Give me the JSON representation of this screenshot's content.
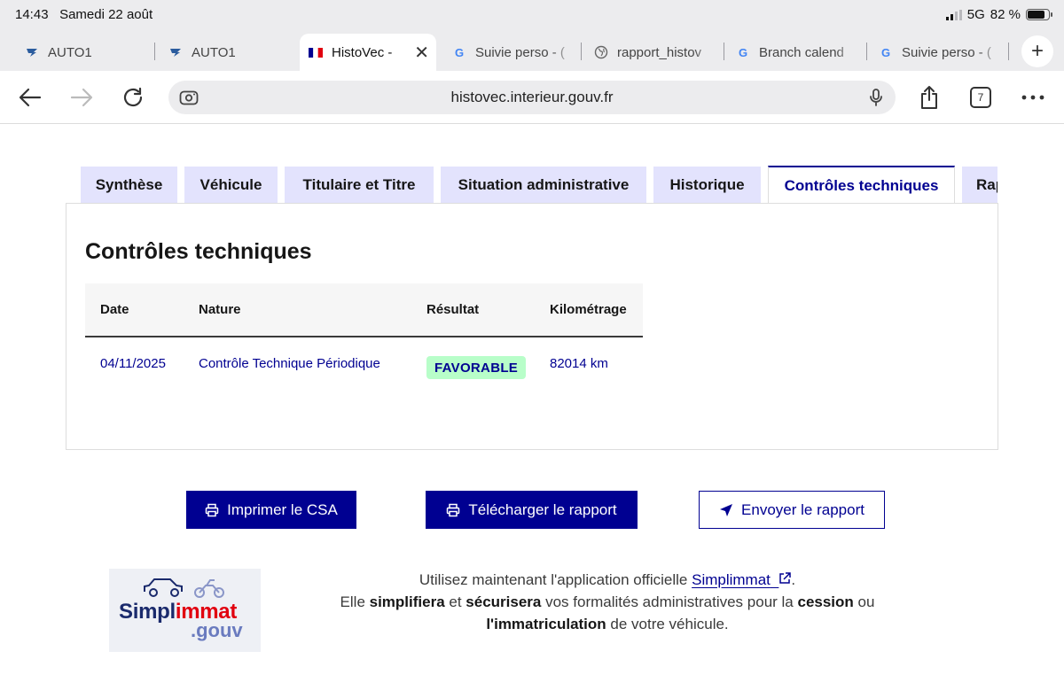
{
  "status": {
    "time": "14:43",
    "date": "Samedi 22 août",
    "network": "5G",
    "battery": "82 %"
  },
  "tabs": [
    {
      "label": "AUTO1",
      "icon": "auto1-favicon"
    },
    {
      "label": "AUTO1",
      "icon": "auto1-favicon"
    },
    {
      "label": "HistoVec - ",
      "icon": "french-flag-favicon",
      "active": true
    },
    {
      "label": "Suivie perso - (",
      "icon": "google-favicon"
    },
    {
      "label": "rapport_histov",
      "icon": "globe-favicon"
    },
    {
      "label": "Branch calend",
      "icon": "google-favicon"
    },
    {
      "label": "Suivie perso - (",
      "icon": "google-favicon"
    }
  ],
  "toolbar": {
    "url": "histovec.interieur.gouv.fr",
    "tab_count": "7"
  },
  "page_tabs": [
    "Synthèse",
    "Véhicule",
    "Titulaire et Titre",
    "Situation administrative",
    "Historique",
    "Contrôles techniques",
    "Rapport"
  ],
  "section": {
    "title": "Contrôles techniques",
    "columns": [
      "Date",
      "Nature",
      "Résultat",
      "Kilométrage"
    ],
    "rows": [
      {
        "date": "04/11/2025",
        "nature": "Contrôle Technique Périodique",
        "result": "FAVORABLE",
        "km": "82014 km"
      }
    ]
  },
  "actions": {
    "print": "Imprimer le CSA",
    "download": "Télécharger le rapport",
    "send": "Envoyer le rapport"
  },
  "promo": {
    "logo_text_1": "Simpl",
    "logo_text_2": "immat",
    "logo_text_3": ".gouv",
    "line1_pre": "Utilisez maintenant l'application officielle ",
    "line1_link": "Simplimmat",
    "line1_post": ".",
    "line2_a": "Elle ",
    "line2_b": "simplifiera",
    "line2_c": " et ",
    "line2_d": "sécurisera",
    "line2_e": " vos formalités administratives pour la ",
    "line2_f": "cession",
    "line2_g": " ou",
    "line3_a": "l'immatriculation",
    "line3_b": " de votre véhicule."
  },
  "colors": {
    "accent": "#000091",
    "tab_bg": "#e3e3fd",
    "success_bg": "#b8fec9",
    "success_text": "#18753c"
  }
}
